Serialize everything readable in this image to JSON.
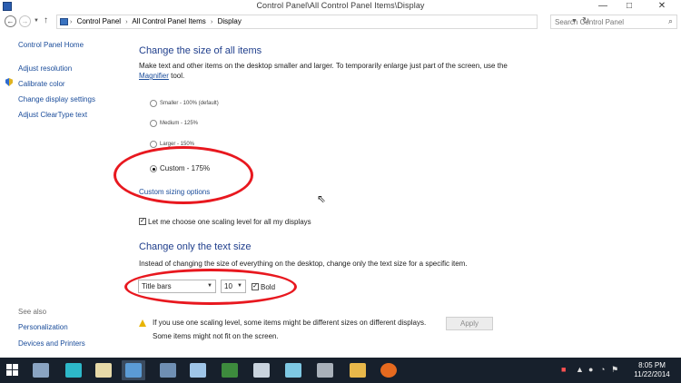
{
  "window": {
    "title": "Control Panel\\All Control Panel Items\\Display",
    "min_label": "—",
    "max_label": "□",
    "close_label": "✕"
  },
  "nav": {
    "back_icon": "back-arrow-icon",
    "forward_icon": "forward-arrow-icon",
    "up_icon": "up-arrow-icon",
    "breadcrumb": [
      "Control Panel",
      "All Control Panel Items",
      "Display"
    ],
    "search_placeholder": "Search Control Panel"
  },
  "sidebar": {
    "items": [
      {
        "label": "Control Panel Home"
      },
      {
        "label": "Adjust resolution"
      },
      {
        "label": "Calibrate color"
      },
      {
        "label": "Change display settings"
      },
      {
        "label": "Adjust ClearType text"
      }
    ],
    "see_also_heading": "See also",
    "see_also": [
      {
        "label": "Personalization"
      },
      {
        "label": "Devices and Printers"
      }
    ]
  },
  "main": {
    "heading1": "Change the size of all items",
    "desc1_part1": "Make text and other items on the desktop smaller and larger. To temporarily enlarge just part of the screen, use the ",
    "desc1_link": "Magnifier",
    "desc1_part2": " tool.",
    "sizes": [
      {
        "label": "Smaller - 100% (default)",
        "selected": false
      },
      {
        "label": "Medium - 125%",
        "selected": false
      },
      {
        "label": "Larger - 150%",
        "selected": false
      },
      {
        "label": "Custom - 175%",
        "selected": true
      }
    ],
    "custom_sizing_link": "Custom sizing options",
    "scaling_checkbox_label": "Let me choose one scaling level for all my displays",
    "scaling_checked": true,
    "heading2": "Change only the text size",
    "desc2": "Instead of changing the size of everything on the desktop, change only the text size for a specific item.",
    "item_select_value": "Title bars",
    "size_select_value": "10",
    "bold_label": "Bold",
    "bold_checked": true,
    "warning_line1": "If you use one scaling level, some items might be different sizes on different displays.",
    "warning_line2": "Some items might not fit on the screen.",
    "apply_label": "Apply",
    "annotation_color": "#e8181f"
  },
  "taskbar": {
    "time": "8:05 PM",
    "date": "11/22/2014",
    "accent": "#17202c"
  }
}
